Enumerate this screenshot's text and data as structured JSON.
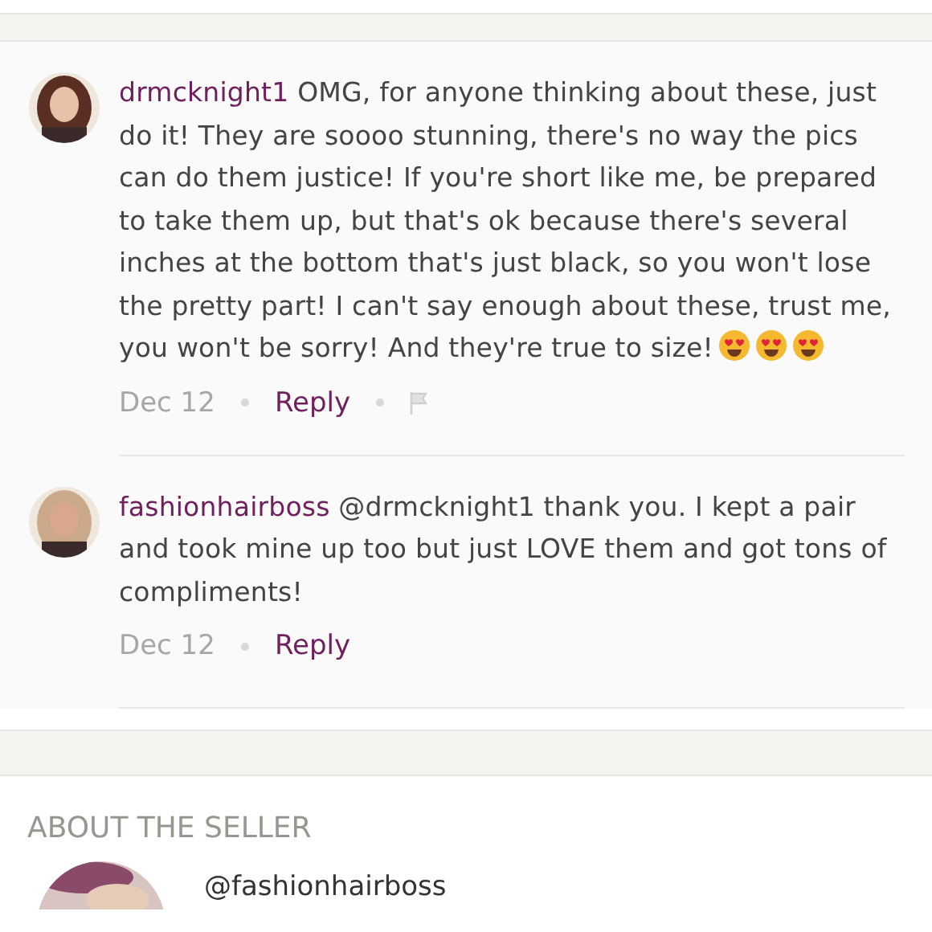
{
  "comments": [
    {
      "username": "drmcknight1",
      "text": "OMG, for anyone thinking about these, just do it! They are soooo stunning, there's no way the pics can do them justice! If you're short like me, be prepared to take them up, but that's ok because there's several inches at the bottom that's just black, so you won't lose the pretty part! I can't say enough about these, trust me, you won't be sorry! And they're true to size!",
      "emojis": [
        {
          "kind": "heart-eyes"
        },
        {
          "kind": "heart-eyes"
        },
        {
          "kind": "heart-eyes"
        }
      ],
      "date": "Dec 12",
      "reply": "Reply",
      "flag": true
    },
    {
      "username": "fashionhairboss",
      "text": "@drmcknight1 thank you. I kept a pair and took mine up too but just LOVE them and got tons of compliments!",
      "date": "Dec 12",
      "reply": "Reply",
      "flag": false
    }
  ],
  "about_seller": {
    "heading": "ABOUT THE SELLER",
    "handle": "@fashionhairboss"
  }
}
